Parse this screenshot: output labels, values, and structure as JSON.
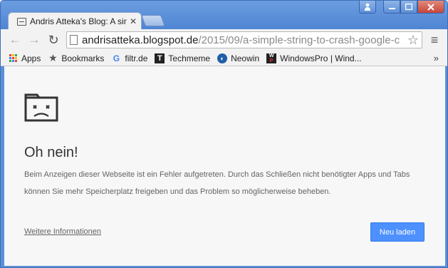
{
  "tab": {
    "title": "Andris Atteka's Blog: A sin",
    "close": "✕"
  },
  "window_controls": {
    "user": "👤",
    "minimize": "—",
    "maximize": "□",
    "close": "✕"
  },
  "toolbar": {
    "back": "←",
    "forward": "→",
    "reload": "↻",
    "url_host": "andrisatteka.blogspot.de",
    "url_path": "/2015/09/a-simple-string-to-crash-google-c",
    "star": "☆",
    "menu": "≡"
  },
  "bookmarks": {
    "items": [
      {
        "label": "Apps",
        "icon": "apps-grid-icon"
      },
      {
        "label": "Bookmarks",
        "icon": "star-icon"
      },
      {
        "label": "filtr.de",
        "icon": "google-g-icon"
      },
      {
        "label": "Techmeme",
        "icon": "techmeme-icon"
      },
      {
        "label": "Neowin",
        "icon": "neowin-icon"
      },
      {
        "label": "WindowsPro | Wind...",
        "icon": "winpro-icon"
      }
    ],
    "more": "»"
  },
  "error_page": {
    "title": "Oh nein!",
    "body": "Beim Anzeigen dieser Webseite ist ein Fehler aufgetreten. Durch das Schließen nicht benötigter Apps und Tabs können Sie mehr Speicherplatz freigeben und das Problem so möglicherweise beheben.",
    "more_link": "Weitere Informationen",
    "reload_button": "Neu laden"
  },
  "colors": {
    "frame": "#5b8fd6",
    "reload_button": "#4d90fe",
    "content_bg": "#f7f7f7"
  }
}
